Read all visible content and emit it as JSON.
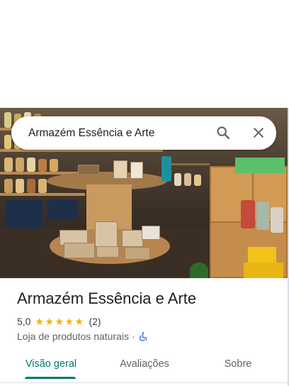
{
  "search": {
    "query": "Armazém Essência e Arte",
    "search_icon": "search-icon",
    "close_icon": "close-icon"
  },
  "place": {
    "name": "Armazém Essência e Arte",
    "rating": "5,0",
    "stars": 5,
    "review_count": "(2)",
    "category": "Loja de produtos naturais",
    "separator": "·",
    "accessibility_icon": "wheelchair-icon"
  },
  "tabs": [
    {
      "label": "Visão geral",
      "active": true
    },
    {
      "label": "Avaliações",
      "active": false
    },
    {
      "label": "Sobre",
      "active": false
    }
  ],
  "colors": {
    "accent": "#00796b",
    "star": "#f5b400",
    "accessibility": "#1a73e8"
  }
}
